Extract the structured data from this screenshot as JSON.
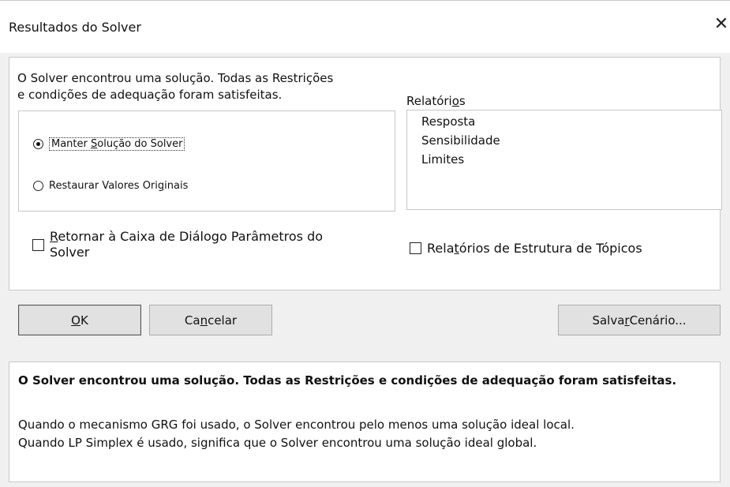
{
  "window": {
    "title": "Resultados do Solver",
    "close_glyph": "✕"
  },
  "message": {
    "line1": "O Solver encontrou uma solução.  Todas as Restrições",
    "line2": "e condições de adequação foram satisfeitas."
  },
  "options": {
    "keep": {
      "pre": "Manter ",
      "key": "S",
      "post": "olução do Solver",
      "checked": true
    },
    "restore": {
      "pre": "Restaurar Valores Ori",
      "key": "g",
      "post": "inais",
      "checked": false
    }
  },
  "reports": {
    "label_pre": "Relatóri",
    "label_key": "o",
    "label_post": "s",
    "items": [
      "Resposta",
      "Sensibilidade",
      "Limites"
    ]
  },
  "checkboxes": {
    "return_dialog": {
      "key": "R",
      "line1_post": "etornar à Caixa de Diálogo Parâmetros do",
      "line2": "Solver",
      "checked": false
    },
    "outline": {
      "pre": "Rela",
      "key": "t",
      "post": "órios de Estrutura de Tópicos",
      "checked": false
    }
  },
  "buttons": {
    "ok": {
      "key": "O",
      "post": "K"
    },
    "cancel": {
      "pre": "Ca",
      "key": "n",
      "post": "celar"
    },
    "save": {
      "pre": "Salva",
      "key": "r",
      "post": " Cenário..."
    }
  },
  "help": {
    "title": "O Solver encontrou uma solução.  Todas as Restrições e condições de adequação foram satisfeitas.",
    "line1": "Quando o mecanismo GRG foi usado, o Solver encontrou pelo menos uma solução ideal local.",
    "line2": "Quando LP Simplex é usado, significa que o Solver encontrou uma solução ideal global."
  }
}
